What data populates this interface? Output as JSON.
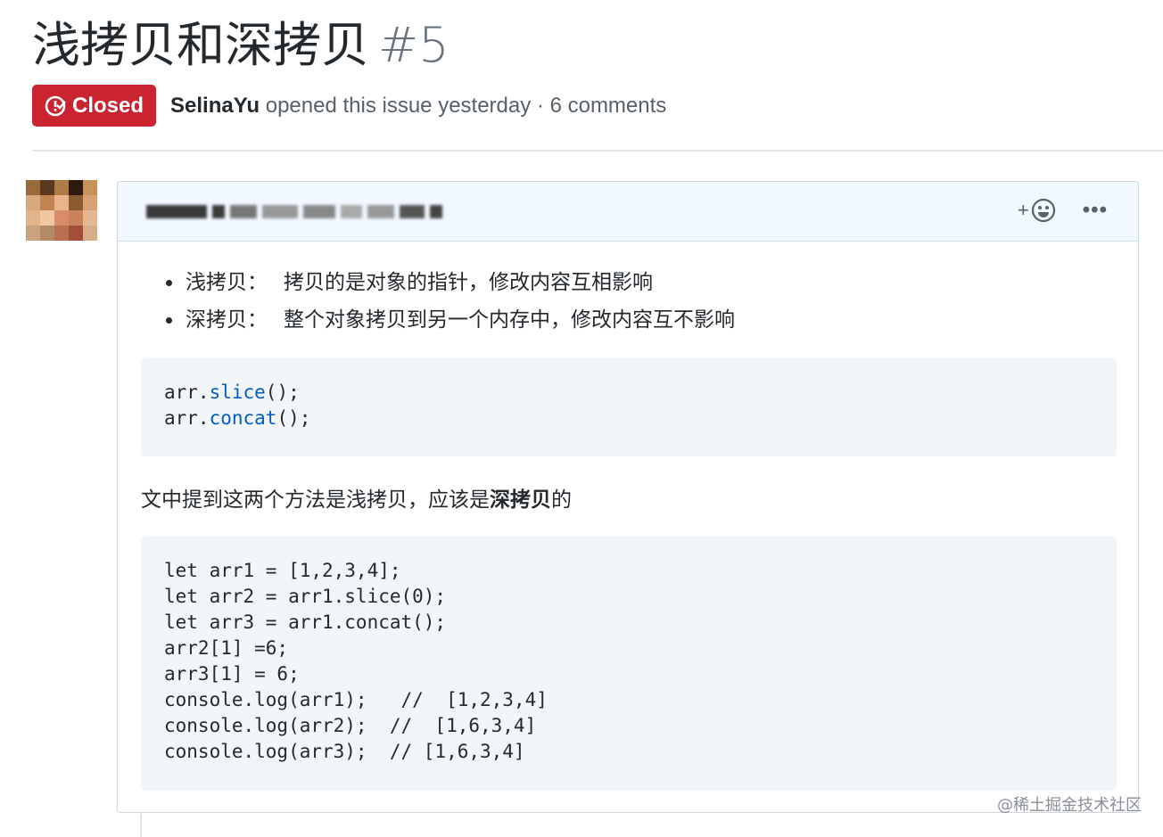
{
  "issue": {
    "title": "浅拷贝和深拷贝",
    "number": "#5",
    "status": "Closed",
    "status_color": "#cb2431",
    "author": "SelinaYu",
    "meta_action": " opened this issue yesterday · 6 comments",
    "status_icon": "issue-closed-icon"
  },
  "comment": {
    "header_icons": {
      "reaction": "smiley-plus-icon",
      "more": "kebab-horizontal-icon"
    },
    "reaction_plus": "+",
    "more_label": "•••",
    "bullets": [
      {
        "term": "浅拷贝：",
        "desc": "拷贝的是对象的指针，修改内容互相影响"
      },
      {
        "term": "深拷贝：",
        "desc": "整个对象拷贝到另一个内存中，修改内容互不影响"
      }
    ],
    "code1": [
      {
        "obj": "arr.",
        "fn": "slice",
        "rest": "();"
      },
      {
        "obj": "arr.",
        "fn": "concat",
        "rest": "();"
      }
    ],
    "paragraph": {
      "text": "文中提到这两个方法是浅拷贝，应该是",
      "bold": "深拷贝",
      "suffix": "的"
    },
    "code2": "let arr1 = [1,2,3,4];\nlet arr2 = arr1.slice(0);\nlet arr3 = arr1.concat();\narr2[1] =6;\narr3[1] = 6;\nconsole.log(arr1);   //  [1,2,3,4]\nconsole.log(arr2);  //  [1,6,3,4]\nconsole.log(arr3);  // [1,6,3,4]"
  },
  "watermark": "@稀土掘金技术社区"
}
